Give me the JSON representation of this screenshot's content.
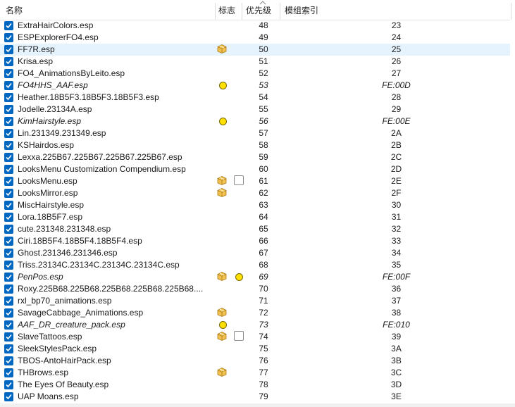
{
  "header": {
    "col_name": "名称",
    "col_flags": "标志",
    "col_priority": "优先级",
    "col_index": "模组索引"
  },
  "colors": {
    "checkbox": "#0067c0",
    "highlight_row": "#e5f3ff",
    "flag_dot": "#ffe000",
    "flag_package": "#f2c14e"
  },
  "rows": [
    {
      "checked": true,
      "name": "ExtraHairColors.esp",
      "priority": "48",
      "index": "23",
      "flags": [],
      "italic": false
    },
    {
      "checked": true,
      "name": "ESPExplorerFO4.esp",
      "priority": "49",
      "index": "24",
      "flags": [],
      "italic": false
    },
    {
      "checked": true,
      "name": "FF7R.esp",
      "priority": "50",
      "index": "25",
      "flags": [
        "package-icon"
      ],
      "italic": false,
      "highlight": true
    },
    {
      "checked": true,
      "name": "Krisa.esp",
      "priority": "51",
      "index": "26",
      "flags": [],
      "italic": false
    },
    {
      "checked": true,
      "name": "FO4_AnimationsByLeito.esp",
      "priority": "52",
      "index": "27",
      "flags": [],
      "italic": false
    },
    {
      "checked": true,
      "name": "FO4HHS_AAF.esp",
      "priority": "53",
      "index": "FE:00D",
      "flags": [
        "dot-icon"
      ],
      "italic": true
    },
    {
      "checked": true,
      "name": "Heather.18B5F3.18B5F3.18B5F3.esp",
      "priority": "54",
      "index": "28",
      "flags": [],
      "italic": false
    },
    {
      "checked": true,
      "name": "Jodelle.23134A.esp",
      "priority": "55",
      "index": "29",
      "flags": [],
      "italic": false
    },
    {
      "checked": true,
      "name": "KimHairstyle.esp",
      "priority": "56",
      "index": "FE:00E",
      "flags": [
        "dot-icon"
      ],
      "italic": true
    },
    {
      "checked": true,
      "name": "Lin.231349.231349.esp",
      "priority": "57",
      "index": "2A",
      "flags": [],
      "italic": false
    },
    {
      "checked": true,
      "name": "KSHairdos.esp",
      "priority": "58",
      "index": "2B",
      "flags": [],
      "italic": false
    },
    {
      "checked": true,
      "name": "Lexxa.225B67.225B67.225B67.225B67.esp",
      "priority": "59",
      "index": "2C",
      "flags": [],
      "italic": false
    },
    {
      "checked": true,
      "name": "LooksMenu Customization Compendium.esp",
      "priority": "60",
      "index": "2D",
      "flags": [],
      "italic": false
    },
    {
      "checked": true,
      "name": "LooksMenu.esp",
      "priority": "61",
      "index": "2E",
      "flags": [
        "package-icon",
        "box-icon"
      ],
      "italic": false
    },
    {
      "checked": true,
      "name": "LooksMirror.esp",
      "priority": "62",
      "index": "2F",
      "flags": [
        "package-icon"
      ],
      "italic": false
    },
    {
      "checked": true,
      "name": "MiscHairstyle.esp",
      "priority": "63",
      "index": "30",
      "flags": [],
      "italic": false
    },
    {
      "checked": true,
      "name": "Lora.18B5F7.esp",
      "priority": "64",
      "index": "31",
      "flags": [],
      "italic": false
    },
    {
      "checked": true,
      "name": "cute.231348.231348.esp",
      "priority": "65",
      "index": "32",
      "flags": [],
      "italic": false
    },
    {
      "checked": true,
      "name": "Ciri.18B5F4.18B5F4.18B5F4.esp",
      "priority": "66",
      "index": "33",
      "flags": [],
      "italic": false
    },
    {
      "checked": true,
      "name": "Ghost.231346.231346.esp",
      "priority": "67",
      "index": "34",
      "flags": [],
      "italic": false
    },
    {
      "checked": true,
      "name": "Triss.23134C.23134C.23134C.23134C.esp",
      "priority": "68",
      "index": "35",
      "flags": [],
      "italic": false
    },
    {
      "checked": true,
      "name": "PenPos.esp",
      "priority": "69",
      "index": "FE:00F",
      "flags": [
        "package-icon",
        "dot-icon"
      ],
      "italic": true
    },
    {
      "checked": true,
      "name": "Roxy.225B68.225B68.225B68.225B68.225B68....",
      "priority": "70",
      "index": "36",
      "flags": [],
      "italic": false
    },
    {
      "checked": true,
      "name": "rxl_bp70_animations.esp",
      "priority": "71",
      "index": "37",
      "flags": [],
      "italic": false
    },
    {
      "checked": true,
      "name": "SavageCabbage_Animations.esp",
      "priority": "72",
      "index": "38",
      "flags": [
        "package-icon"
      ],
      "italic": false
    },
    {
      "checked": true,
      "name": "AAF_DR_creature_pack.esp",
      "priority": "73",
      "index": "FE:010",
      "flags": [
        "dot-icon"
      ],
      "italic": true
    },
    {
      "checked": true,
      "name": "SlaveTattoos.esp",
      "priority": "74",
      "index": "39",
      "flags": [
        "package-icon",
        "box-icon"
      ],
      "italic": false
    },
    {
      "checked": true,
      "name": "SleekStylesPack.esp",
      "priority": "75",
      "index": "3A",
      "flags": [],
      "italic": false
    },
    {
      "checked": true,
      "name": "TBOS-AntoHairPack.esp",
      "priority": "76",
      "index": "3B",
      "flags": [],
      "italic": false
    },
    {
      "checked": true,
      "name": "THBrows.esp",
      "priority": "77",
      "index": "3C",
      "flags": [
        "package-icon"
      ],
      "italic": false
    },
    {
      "checked": true,
      "name": "The Eyes Of Beauty.esp",
      "priority": "78",
      "index": "3D",
      "flags": [],
      "italic": false
    },
    {
      "checked": true,
      "name": "UAP Moans.esp",
      "priority": "79",
      "index": "3E",
      "flags": [],
      "italic": false
    }
  ]
}
